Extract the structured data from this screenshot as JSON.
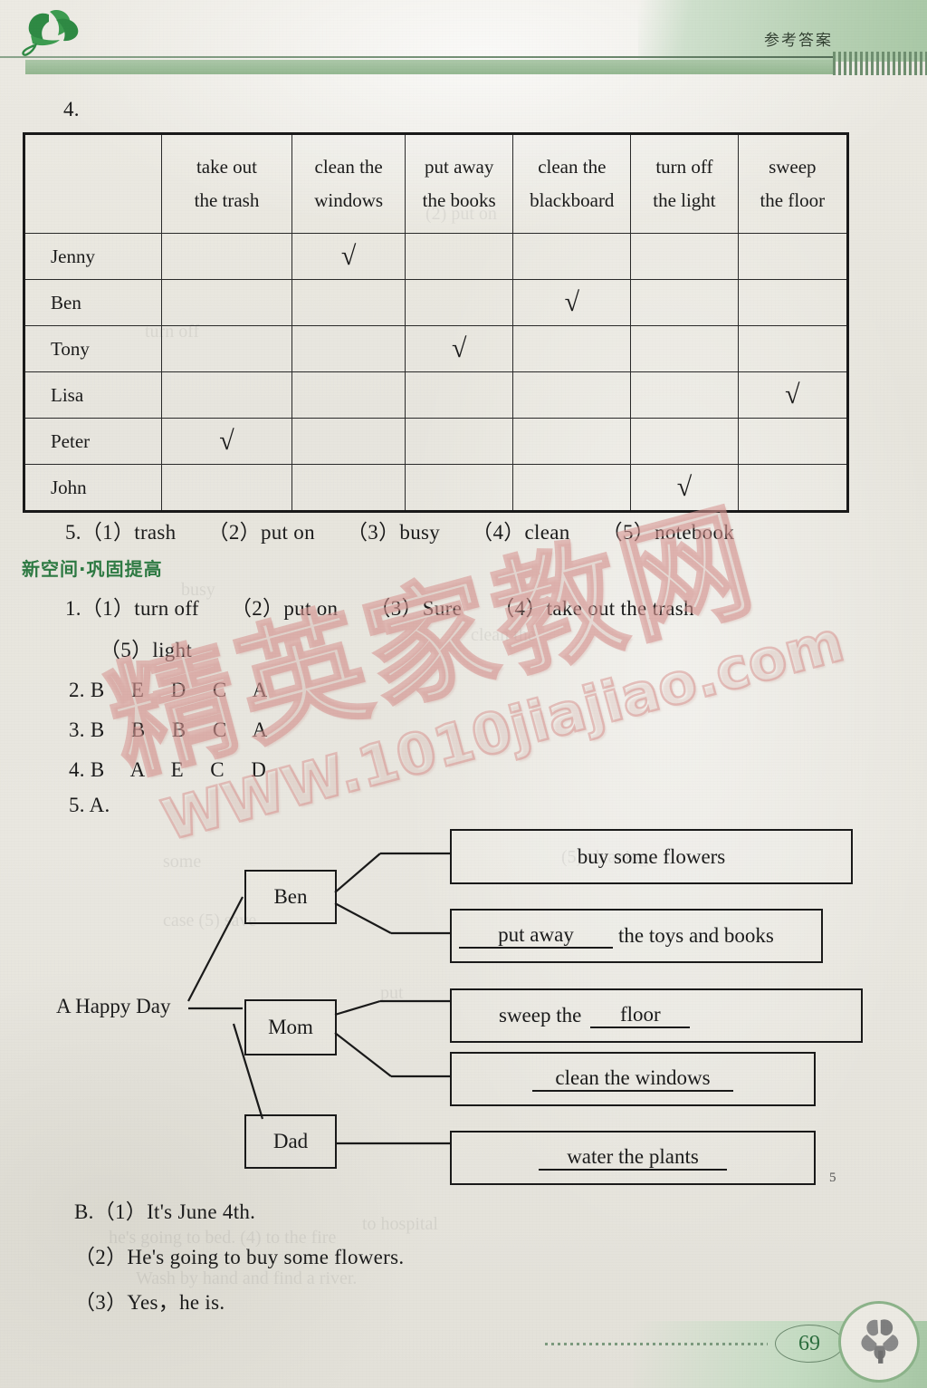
{
  "header": {
    "title": "参考答案",
    "leaf_icon": "ginkgo-leaf-icon"
  },
  "exercise4": {
    "number": "4.",
    "columns": [
      "",
      "take out\nthe trash",
      "clean the\nwindows",
      "put away\nthe books",
      "clean the\nblackboard",
      "turn off\nthe light",
      "sweep\nthe floor"
    ],
    "column_lines": [
      [
        "",
        ""
      ],
      [
        "take out",
        "the trash"
      ],
      [
        "clean the",
        "windows"
      ],
      [
        "put away",
        "the books"
      ],
      [
        "clean the",
        "blackboard"
      ],
      [
        "turn off",
        "the light"
      ],
      [
        "sweep",
        "the floor"
      ]
    ],
    "check_glyph": "√",
    "rows": [
      {
        "name": "Jenny",
        "checks": [
          false,
          true,
          false,
          false,
          false,
          false
        ]
      },
      {
        "name": "Ben",
        "checks": [
          false,
          false,
          false,
          true,
          false,
          false
        ]
      },
      {
        "name": "Tony",
        "checks": [
          false,
          false,
          true,
          false,
          false,
          false
        ]
      },
      {
        "name": "Lisa",
        "checks": [
          false,
          false,
          false,
          false,
          false,
          true
        ]
      },
      {
        "name": "Peter",
        "checks": [
          true,
          false,
          false,
          false,
          false,
          false
        ]
      },
      {
        "name": "John",
        "checks": [
          false,
          false,
          false,
          false,
          true,
          false
        ]
      }
    ]
  },
  "exercise5_top": "5.（1）trash　　（2）put on　　（3）busy　　（4）clean　　（5）notebook",
  "section_heading": "新空间·巩固提高",
  "new_section": {
    "item1_line1": "1.（1）turn off　　（2）put on　　（3）Sure　　（4）take out the trash",
    "item1_line2": "（5）light",
    "item2": "2. B　 E　 D　 C　 A",
    "item3": "3. B　 B　 B　 C　 A",
    "item4": "4. B　 A　 E　 C　 D",
    "item5": "5. A."
  },
  "diagram": {
    "root": "A Happy Day",
    "nodes": [
      {
        "label": "Ben"
      },
      {
        "label": "Mom"
      },
      {
        "label": "Dad"
      }
    ],
    "actions": [
      {
        "prefix": "",
        "blank": "",
        "suffix": "buy some flowers",
        "style": "centered"
      },
      {
        "prefix": "",
        "blank": "put away",
        "suffix": "the toys and books",
        "style": "blank-left"
      },
      {
        "prefix": "sweep the",
        "blank": "floor",
        "suffix": "",
        "style": "blank-right"
      },
      {
        "prefix": "",
        "blank": "clean the windows",
        "suffix": "",
        "style": "blank-center"
      },
      {
        "prefix": "",
        "blank": "water the plants",
        "suffix": "",
        "style": "blank-center"
      }
    ],
    "margin_mark": "5"
  },
  "partB": {
    "line1": "B.（1）It's June 4th.",
    "line2": "（2）He's going to buy some flowers.",
    "line3": "（3）Yes，he is."
  },
  "footer": {
    "page_number": "69",
    "flower_icon": "flower-badge-icon"
  },
  "watermark": {
    "chinese": "精英家教网",
    "url": "WWW.1010jiajiao.com"
  },
  "colors": {
    "green_accent": "#2e7a43",
    "header_green": "#a9c8a6",
    "watermark_pink": "#d89692",
    "ink": "#1a1a1a"
  }
}
